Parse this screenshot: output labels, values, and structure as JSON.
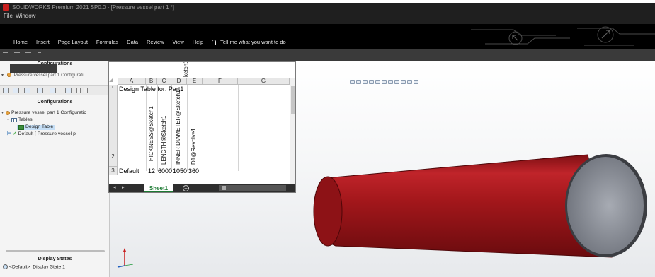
{
  "titlebar": {
    "title": "SOLIDWORKS Premium 2021 SP0.0 - [Pressure vessel part 1 *]",
    "menu_file": "File",
    "menu_window": "Window"
  },
  "ribbon": {
    "tabs": [
      "Home",
      "Insert",
      "Page Layout",
      "Formulas",
      "Data",
      "Review",
      "View",
      "Help"
    ],
    "tellme": "Tell me what you want to do"
  },
  "left_panel": {
    "top_header": "Configurations",
    "top_tree_item": "Pressure vessel part 1 Configurati",
    "header": "Configurations",
    "tree": {
      "root": "Pressure vessel part 1 Configuratic",
      "tables": "Tables",
      "design_table": "Design Table",
      "default": "Default [ Pressure vessel p"
    },
    "display_states_header": "Display States",
    "display_state": "<Default>_Display State 1"
  },
  "spreadsheet": {
    "columns": [
      "A",
      "B",
      "C",
      "D",
      "E",
      "F",
      "G"
    ],
    "rows": [
      "1",
      "2",
      "3"
    ],
    "title_cell": "Design Table for: Part1",
    "top_partial": "ketch1",
    "headers": [
      "THICKNESS@Sketch1",
      "LENGTH@Sketch1",
      "INNER DIAMETER@Sketch1",
      "D1@Revolve1"
    ],
    "row3_label": "Default",
    "row3_values": [
      "12",
      "6000",
      "1050",
      "360"
    ],
    "sheet_tab": "Sheet1"
  },
  "colors": {
    "cylinder": "#a3171b",
    "ribbon": "#000000",
    "titlebar": "#1f1f1f"
  }
}
